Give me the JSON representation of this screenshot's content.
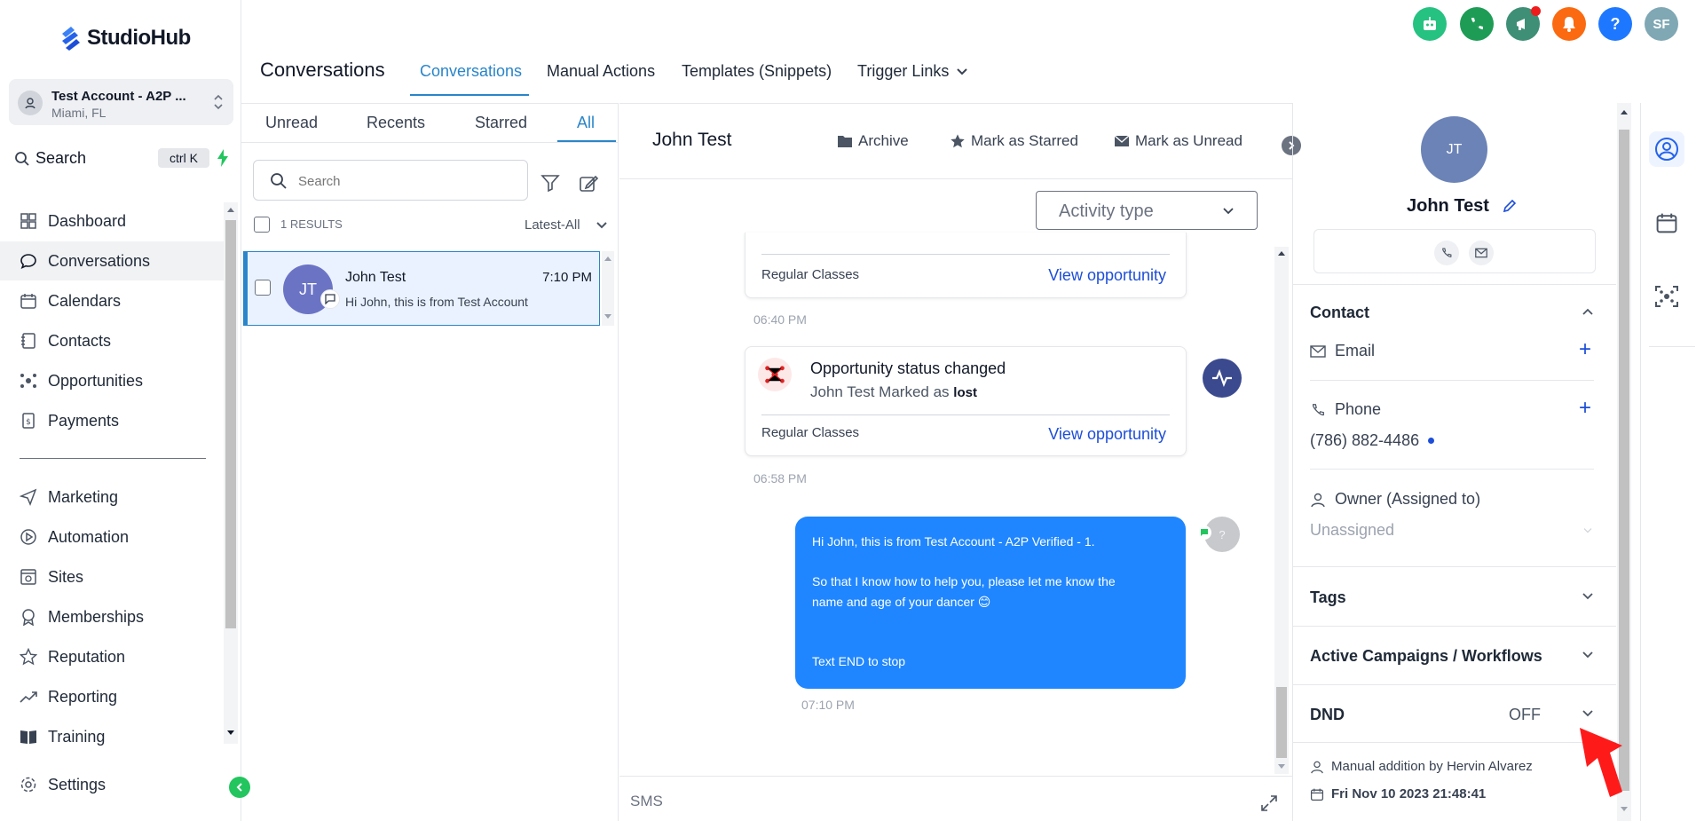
{
  "brand": {
    "name": "StudioHub"
  },
  "account": {
    "name": "Test Account - A2P ...",
    "location": "Miami, FL"
  },
  "sidebar": {
    "search_label": "Search",
    "search_shortcut": "ctrl K",
    "items": [
      {
        "label": "Dashboard",
        "icon": "dashboard-icon"
      },
      {
        "label": "Conversations",
        "icon": "chat-icon"
      },
      {
        "label": "Calendars",
        "icon": "calendar-icon"
      },
      {
        "label": "Contacts",
        "icon": "contacts-icon"
      },
      {
        "label": "Opportunities",
        "icon": "opportunities-icon"
      },
      {
        "label": "Payments",
        "icon": "payments-icon"
      },
      {
        "label": "Marketing",
        "icon": "send-icon"
      },
      {
        "label": "Automation",
        "icon": "automation-icon"
      },
      {
        "label": "Sites",
        "icon": "sites-icon"
      },
      {
        "label": "Memberships",
        "icon": "badge-icon"
      },
      {
        "label": "Reputation",
        "icon": "star-icon"
      },
      {
        "label": "Reporting",
        "icon": "chart-icon"
      },
      {
        "label": "Training",
        "icon": "book-icon"
      }
    ],
    "settings_label": "Settings"
  },
  "header": {
    "title": "Conversations",
    "tabs": [
      {
        "label": "Conversations"
      },
      {
        "label": "Manual Actions"
      },
      {
        "label": "Templates (Snippets)"
      },
      {
        "label": "Trigger Links"
      }
    ],
    "user_initials": "SF",
    "help_symbol": "?"
  },
  "list": {
    "tabs": [
      "Unread",
      "Recents",
      "Starred",
      "All"
    ],
    "search_placeholder": "Search",
    "results": "1 RESULTS",
    "sort": "Latest-All",
    "conversations": [
      {
        "initials": "JT",
        "name": "John Test",
        "time": "7:10 PM",
        "preview": "Hi John, this is from Test Account"
      }
    ]
  },
  "chat": {
    "contact_name": "John Test",
    "actions": {
      "archive": "Archive",
      "star": "Mark as Starred",
      "unread": "Mark as Unread"
    },
    "activity_type": "Activity type",
    "card1": {
      "subject": "Regular Classes",
      "link": "View opportunity",
      "time": "06:40 PM"
    },
    "card2": {
      "title": "Opportunity status changed",
      "detail_prefix": "John Test Marked as",
      "detail_status": "lost",
      "subject": "Regular Classes",
      "link": "View opportunity",
      "time": "06:58 PM"
    },
    "message": {
      "line1": "Hi John, this is  from Test Account - A2P Verified - 1.",
      "line2": "So that I know how to help you, please let me know the",
      "line3": "name and age of your dancer 😊",
      "line4": "Text END to stop",
      "time": "07:10 PM",
      "avatar": "?"
    },
    "channel": "SMS"
  },
  "contact_panel": {
    "initials": "JT",
    "name": "John Test",
    "section_contact": "Contact",
    "email_label": "Email",
    "phone_label": "Phone",
    "phone_value": "(786) 882-4486",
    "owner_label": "Owner (Assigned to)",
    "owner_value": "Unassigned",
    "tags": "Tags",
    "campaigns": "Active Campaigns / Workflows",
    "dnd": "DND",
    "dnd_value": "OFF",
    "added_by": "Manual addition by Hervin Alvarez",
    "added_date": "Fri Nov 10 2023 21:48:41"
  },
  "colors": {
    "accent": "#2a85c9",
    "bubble": "#1f86ff",
    "link": "#1d4ed8",
    "annotation_arrow": "#ff1a1a"
  }
}
